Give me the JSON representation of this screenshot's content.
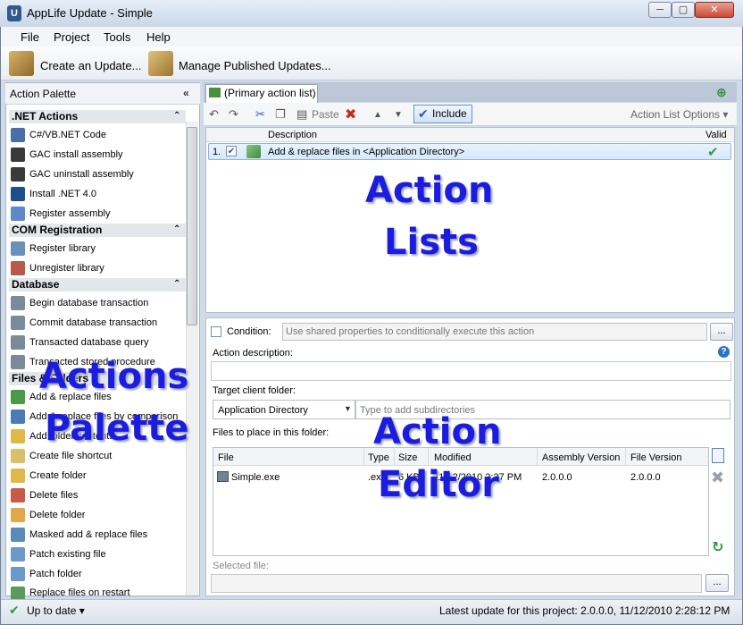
{
  "window": {
    "title": "AppLife Update - Simple",
    "app_icon": "U"
  },
  "menu": [
    "File",
    "Project",
    "Tools",
    "Help"
  ],
  "toolbar": {
    "create_label": "Create an Update...",
    "manage_label": "Manage Published Updates..."
  },
  "palette": {
    "title": "Action Palette",
    "collapse_glyph": "«",
    "categories": [
      {
        "name": ".NET Actions",
        "items": [
          "C#/VB.NET Code",
          "GAC install assembly",
          "GAC uninstall assembly",
          "Install .NET 4.0",
          "Register assembly"
        ]
      },
      {
        "name": "COM Registration",
        "items": [
          "Register library",
          "Unregister library"
        ]
      },
      {
        "name": "Database",
        "items": [
          "Begin database transaction",
          "Commit database transaction",
          "Transacted database query",
          "Transacted stored procedure"
        ]
      },
      {
        "name": "Files & Folders",
        "items": [
          "Add & replace files",
          "Add & replace files by comparison",
          "Add folder contents",
          "Create file shortcut",
          "Create folder",
          "Delete files",
          "Delete folder",
          "Masked add & replace files",
          "Patch existing file",
          "Patch folder",
          "Replace files on restart"
        ]
      }
    ]
  },
  "tab": {
    "label": "(Primary action list)"
  },
  "list_toolbar": {
    "paste_label": "Paste",
    "include_label": "Include",
    "options_label": "Action List Options ▾"
  },
  "action_list": {
    "columns": {
      "description": "Description",
      "valid": "Valid"
    },
    "rows": [
      {
        "num": "1.",
        "description": "Add & replace files in <Application Directory>",
        "valid": "✔"
      }
    ]
  },
  "editor": {
    "condition_label": "Condition:",
    "condition_placeholder": "Use shared properties to conditionally execute this action",
    "ellipsis": "...",
    "description_label": "Action description:",
    "target_label": "Target client folder:",
    "target_value": "Application Directory",
    "subdir_placeholder": "Type to add subdirectories",
    "files_label": "Files to place in this folder:",
    "file_columns": [
      "File",
      "Type",
      "Size",
      "Modified",
      "Assembly Version",
      "File Version"
    ],
    "files": [
      {
        "file": "Simple.exe",
        "type": ".exe",
        "size": "6 KB",
        "modified": "11/12/2010 2:27 PM",
        "assembly_version": "2.0.0.0",
        "file_version": "2.0.0.0"
      }
    ],
    "selected_label": "Selected file:"
  },
  "status": {
    "state": "Up to date ▾",
    "latest": "Latest update for this project: 2.0.0.0, 11/12/2010 2:28:12 PM"
  },
  "overlays": {
    "action_lists_1": "Action",
    "action_lists_2": "Lists",
    "actions_palette_1": "Actions",
    "actions_palette_2": "Palette",
    "action_editor_1": "Action",
    "action_editor_2": "Editor"
  }
}
